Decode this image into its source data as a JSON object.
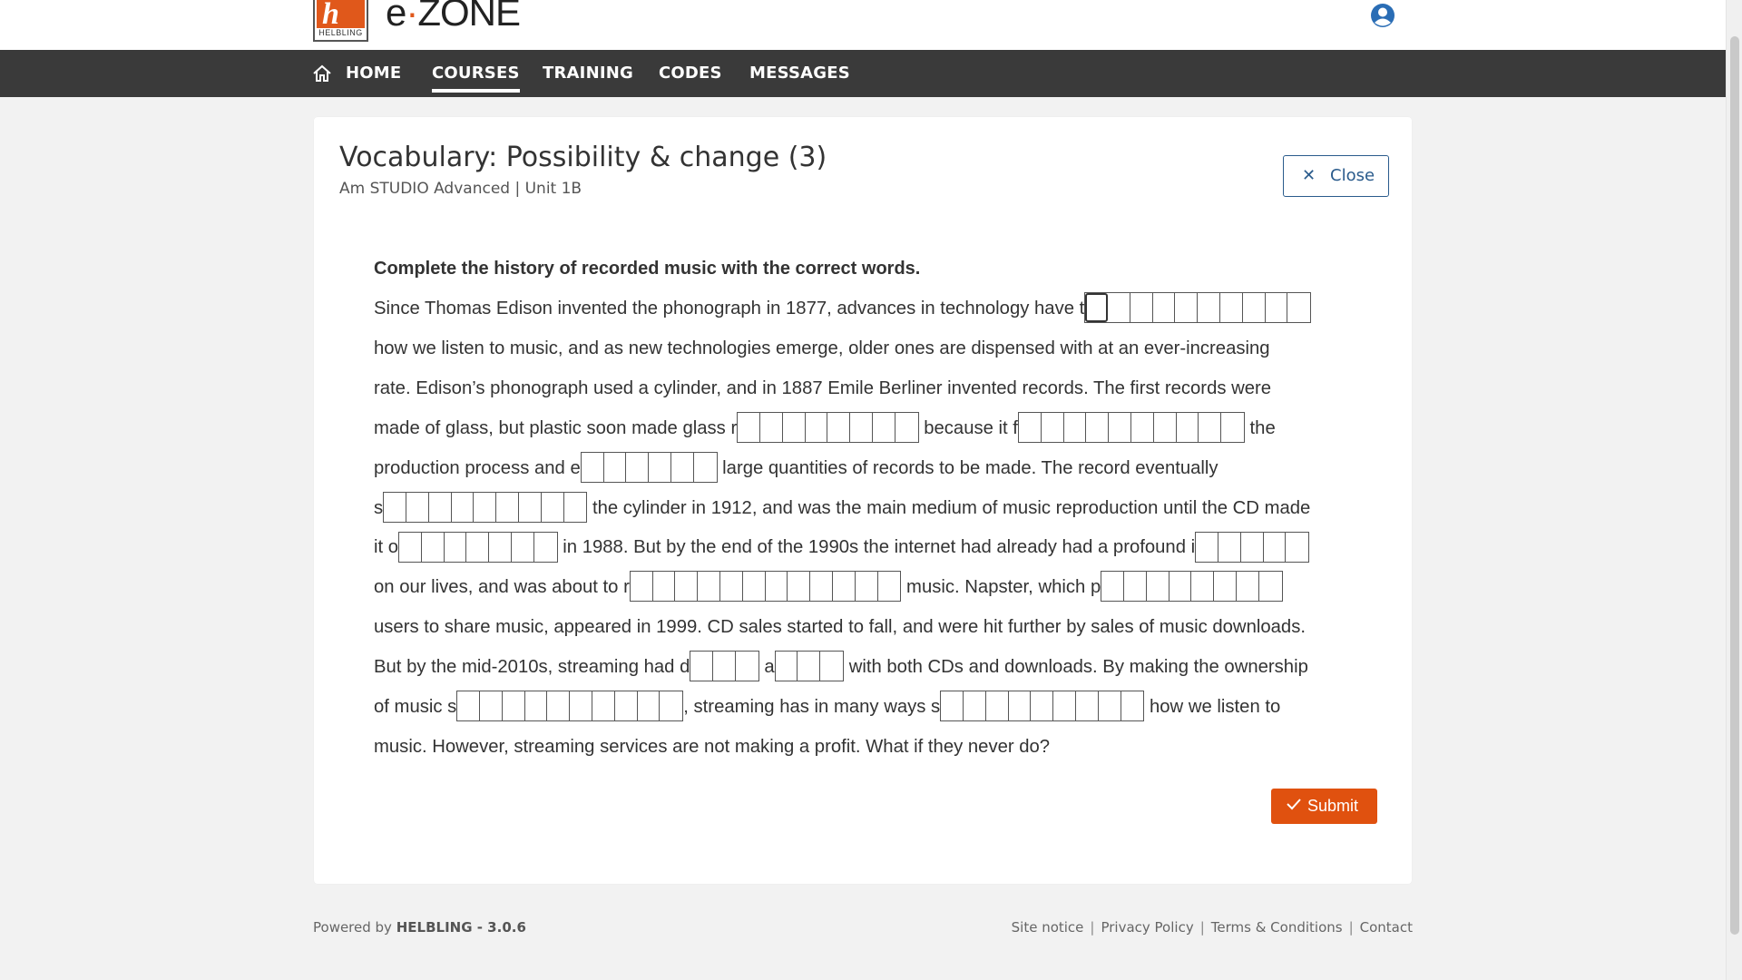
{
  "header": {
    "logo_text": "HELBLING",
    "brand_e": "e",
    "brand_dot": "·",
    "brand_zone": "ZONE"
  },
  "nav": {
    "items": [
      {
        "label": "HOME",
        "active": false
      },
      {
        "label": "COURSES",
        "active": true
      },
      {
        "label": "TRAINING",
        "active": false
      },
      {
        "label": "CODES",
        "active": false
      },
      {
        "label": "MESSAGES",
        "active": false
      }
    ]
  },
  "exercise": {
    "title": "Vocabulary: Possibility & change (3)",
    "subtitle": "Am STUDIO Advanced | Unit 1B",
    "close_label": "Close",
    "instruction": "Complete the history of recorded music with the correct words.",
    "submit_label": "Submit",
    "lines": [
      [
        {
          "t": "Since Thomas Edison invented the phonograph in 1877, advances in technology have t"
        },
        {
          "gap": 10
        }
      ],
      [
        {
          "t": "how we listen to music, and as new technologies emerge, older ones are dispensed with at an ever-increasing"
        }
      ],
      [
        {
          "t": "rate. Edison’s phonograph used a cylinder, and in 1887 Emile Berliner invented records. The first records were"
        }
      ],
      [
        {
          "t": "made of glass, but plastic soon made glass r"
        },
        {
          "gap": 8
        },
        {
          "t": " because it f"
        },
        {
          "gap": 10
        },
        {
          "t": " the"
        }
      ],
      [
        {
          "t": "production process and e"
        },
        {
          "gap": 6
        },
        {
          "t": " large quantities of records to be made. The record eventually"
        }
      ],
      [
        {
          "t": "s"
        },
        {
          "gap": 9
        },
        {
          "t": " the cylinder in 1912, and was the main medium of music reproduction until the CD made"
        }
      ],
      [
        {
          "t": "it o"
        },
        {
          "gap": 7
        },
        {
          "t": " in 1988. But by the end of the 1990s the internet had already had a profound i"
        },
        {
          "gap": 5
        }
      ],
      [
        {
          "t": "on our lives, and was about to r"
        },
        {
          "gap": 12
        },
        {
          "t": " music. Napster, which p"
        },
        {
          "gap": 8
        }
      ],
      [
        {
          "t": "users to share music, appeared in 1999. CD sales started to fall, and were hit further by sales of music downloads."
        }
      ],
      [
        {
          "t": "But by the mid-2010s, streaming had d"
        },
        {
          "gap": 3
        },
        {
          "t": " a"
        },
        {
          "gap": 3
        },
        {
          "t": " with both CDs and downloads. By making the ownership"
        }
      ],
      [
        {
          "t": "of music s"
        },
        {
          "gap": 10
        },
        {
          "t": ", streaming has in many ways s"
        },
        {
          "gap": 9
        },
        {
          "t": " how we listen to"
        }
      ],
      [
        {
          "t": "music. However, streaming services are not making a profit. What if they never do?"
        }
      ]
    ]
  },
  "footer": {
    "powered_prefix": "Powered by ",
    "powered_brand": "HELBLING - 3.0.6",
    "links": [
      "Site notice",
      "Privacy Policy",
      "Terms & Conditions",
      "Contact"
    ]
  },
  "colors": {
    "accent": "#e0510f",
    "nav_bg": "#3a3a3a",
    "link_blue": "#2a5b8c"
  }
}
